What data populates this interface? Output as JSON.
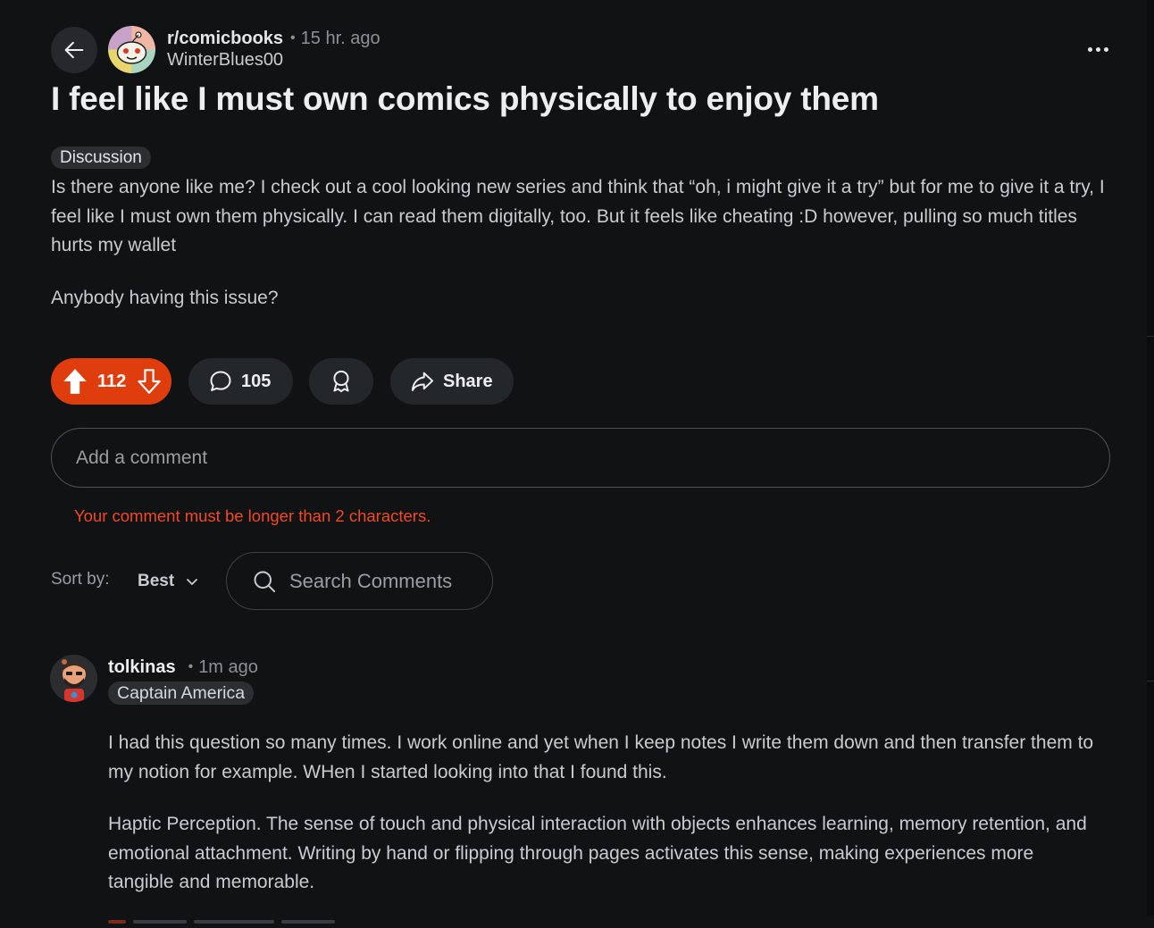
{
  "post": {
    "subreddit": "r/comicbooks",
    "time": "15 hr. ago",
    "author": "WinterBlues00",
    "title": "I feel like I must own comics physically to enjoy them",
    "flair": "Discussion",
    "body_p1": "Is there anyone like me? I check out a cool looking new series and think that “oh, i might give it a try” but for me to give it a try, I feel like I must own them physically. I can read them digitally, too. But it feels like cheating :D however, pulling so much titles hurts my wallet",
    "body_p2": "Anybody having this issue?"
  },
  "actions": {
    "score": "112",
    "comments": "105",
    "share_label": "Share"
  },
  "comment_box": {
    "placeholder": "Add a comment",
    "error": "Your comment must be longer than 2 characters."
  },
  "sort": {
    "label": "Sort by:",
    "value": "Best",
    "search_placeholder": "Search Comments"
  },
  "comment": {
    "user": "tolkinas",
    "time": "1m ago",
    "flair": "Captain America",
    "p1": "I had this question so many times. I work online and yet when I keep notes I write them down and then transfer them to my notion for example. WHen I started looking into that I found this.",
    "p2": "Haptic Perception. The sense of touch and physical interaction with objects enhances learning, memory retention, and emotional attachment. Writing by hand or flipping through pages activates this sense, making experiences more tangible and memorable."
  },
  "colors": {
    "background": "#111214",
    "upvote_active": "#e03d0f",
    "error": "#f04a27",
    "pill": "#24272a"
  },
  "icons": [
    "back-arrow-icon",
    "more-dots-icon",
    "upvote-icon",
    "downvote-icon",
    "comment-bubble-icon",
    "award-icon",
    "share-icon",
    "search-icon",
    "chevron-down-icon"
  ]
}
